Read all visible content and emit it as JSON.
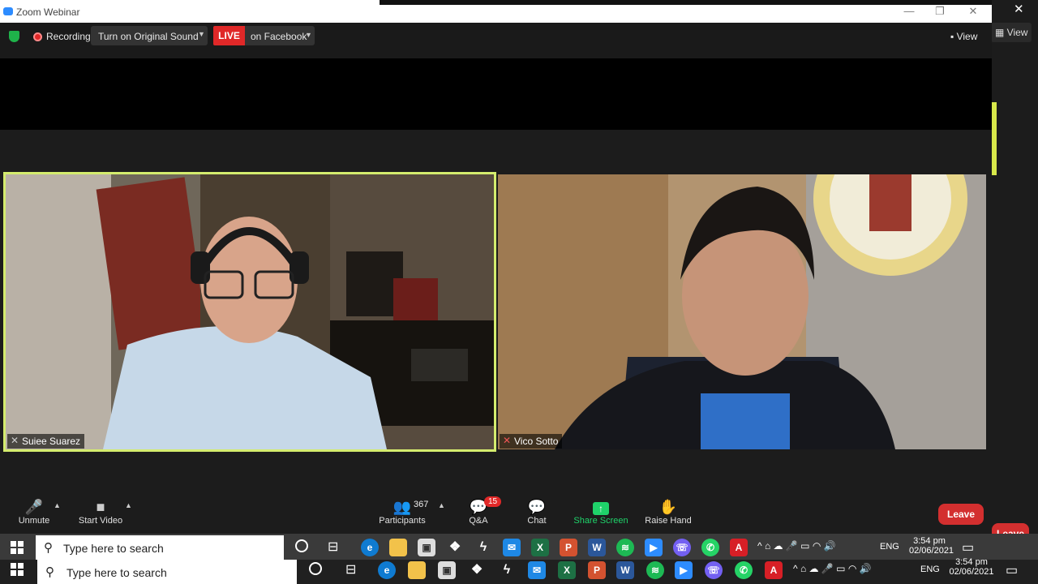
{
  "window": {
    "title": "Zoom Webinar"
  },
  "toolbar": {
    "recording_label": "Recording",
    "original_sound_label": "Turn on Original Sound",
    "live_badge": "LIVE",
    "live_destination": "on Facebook",
    "view_label": "View"
  },
  "right_strip": {
    "close_glyph": "✕",
    "view_label": "View",
    "leave_label": "Leave"
  },
  "participants_video": [
    {
      "name": "Suiee Suarez",
      "active_speaker": true
    },
    {
      "name": "Vico Sotto",
      "active_speaker": false
    }
  ],
  "controls": {
    "unmute_label": "Unmute",
    "start_video_label": "Start Video",
    "participants_label": "Participants",
    "participants_count": "367",
    "qa_label": "Q&A",
    "qa_badge": "15",
    "chat_label": "Chat",
    "share_screen_label": "Share Screen",
    "raise_hand_label": "Raise Hand",
    "leave_label": "Leave"
  },
  "taskbar_upper": {
    "search_placeholder": "Type here to search",
    "language": "ENG",
    "time": "3:54 pm",
    "date": "02/06/2021"
  },
  "taskbar_lower": {
    "search_placeholder": "Type here to search",
    "language": "ENG",
    "time": "3:54 pm",
    "date": "02/06/2021"
  },
  "colors": {
    "accent_green": "#d4ec6e",
    "live_red": "#e02828",
    "leave_red": "#d32f2f",
    "share_green": "#1fd26a"
  }
}
